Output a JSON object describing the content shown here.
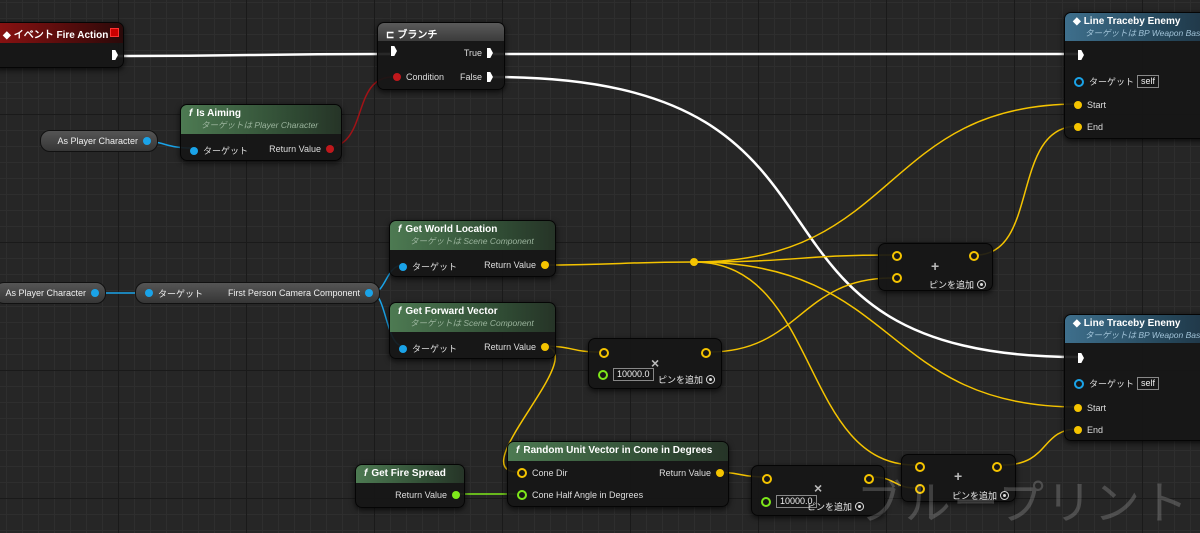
{
  "watermark": "ブループリント",
  "nodes": {
    "event": {
      "title": "イベント Fire Action"
    },
    "branch": {
      "title": "ブランチ",
      "true_label": "True",
      "false_label": "False",
      "condition_label": "Condition"
    },
    "is_aiming": {
      "title": "Is Aiming",
      "subtitle": "ターゲットは Player Character",
      "target_label": "ターゲット",
      "return_label": "Return Value"
    },
    "as_player_1": {
      "label": "As Player Character"
    },
    "as_player_2": {
      "label": "As Player Character"
    },
    "camera_comp": {
      "target_label": "ターゲット",
      "label": "First Person Camera Component"
    },
    "get_world_location": {
      "title": "Get World Location",
      "subtitle": "ターゲットは Scene Component",
      "target_label": "ターゲット",
      "return_label": "Return Value"
    },
    "get_forward_vector": {
      "title": "Get Forward Vector",
      "subtitle": "ターゲットは Scene Component",
      "target_label": "ターゲット",
      "return_label": "Return Value"
    },
    "get_fire_spread": {
      "title": "Get Fire Spread",
      "return_label": "Return Value"
    },
    "random_unit_vector": {
      "title": "Random Unit Vector in Cone in Degrees",
      "cone_dir_label": "Cone Dir",
      "return_label": "Return Value",
      "half_angle_label": "Cone Half Angle in Degrees"
    },
    "add_1": {
      "add_pin_label": "ピンを追加",
      "symbol": "+"
    },
    "mult_1": {
      "value": "10000.0",
      "add_pin_label": "ピンを追加",
      "symbol": "×"
    },
    "add_2": {
      "add_pin_label": "ピンを追加",
      "symbol": "+"
    },
    "mult_2": {
      "value": "10000.0",
      "add_pin_label": "ピンを追加",
      "symbol": "×"
    },
    "line_trace_1": {
      "title": "Line Traceby Enemy",
      "subtitle": "ターゲットは BP Weapon Base",
      "target_label": "ターゲット",
      "target_value": "self",
      "start_label": "Start",
      "end_label": "End"
    },
    "line_trace_2": {
      "title": "Line Traceby Enemy",
      "subtitle": "ターゲットは BP Weapon Base",
      "target_label": "ターゲット",
      "target_value": "self",
      "start_label": "Start",
      "end_label": "End"
    }
  },
  "colors": {
    "exec_wire": "#ffffff",
    "vector_wire": "#f5c400",
    "object_wire": "#1aa3e8",
    "bool_wire": "#a01317",
    "float_wire": "#7ee81a"
  }
}
